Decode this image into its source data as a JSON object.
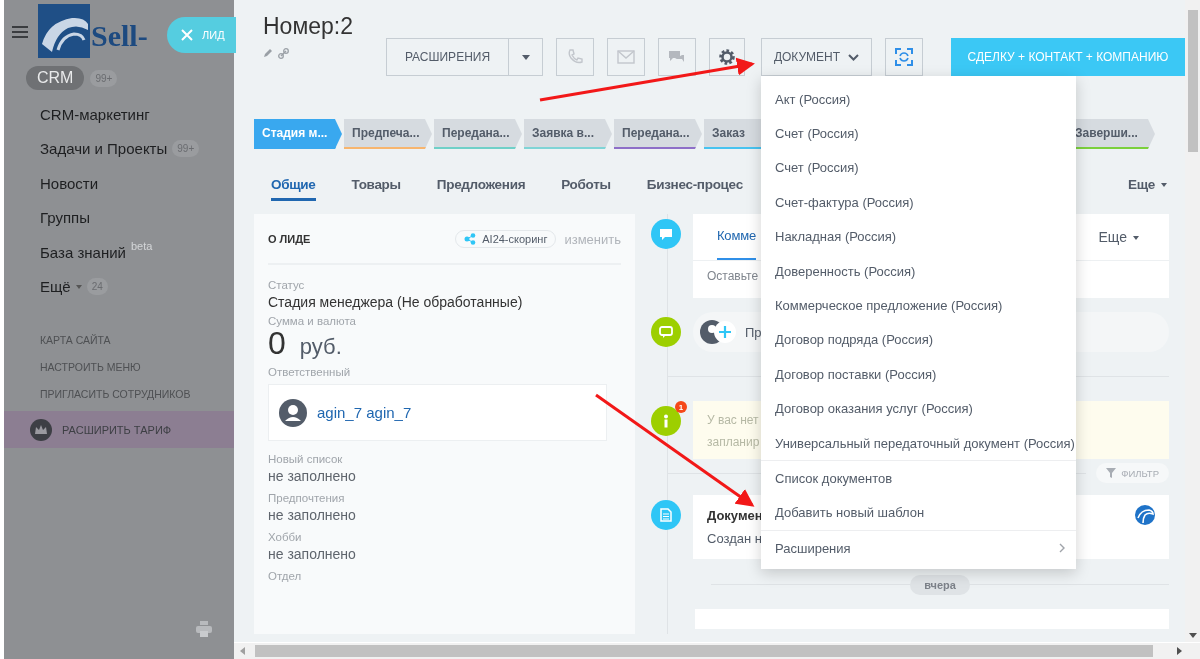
{
  "sidebar": {
    "logo_text": "Sell-",
    "close_tab": {
      "label": "ЛИД"
    },
    "crm": {
      "label": "CRM",
      "counter": "99+"
    },
    "items": [
      {
        "label": "CRM-маркетинг",
        "kind": "plain"
      },
      {
        "label": "Задачи и Проекты",
        "kind": "plain",
        "counter": "99+"
      },
      {
        "label": "Новости",
        "kind": "plain"
      },
      {
        "label": "Группы",
        "kind": "plain"
      },
      {
        "label": "База знаний",
        "kind": "plain",
        "sup": "beta"
      },
      {
        "label": "Ещё",
        "kind": "more",
        "counter": "24"
      }
    ],
    "links": [
      "КАРТА САЙТА",
      "НАСТРОИТЬ МЕНЮ",
      "ПРИГЛАСИТЬ СОТРУДНИКОВ"
    ],
    "upgrade": "РАСШИРИТЬ ТАРИФ"
  },
  "header": {
    "title": "Номер:2",
    "extensions_button": "РАСШИРЕНИЯ",
    "document_button": "ДОКУМЕНТ",
    "create_button": "СДЕЛКУ + КОНТАКТ + КОМПАНИЮ"
  },
  "stages": [
    {
      "label": "Стадия м...",
      "selected": true,
      "color": "#39a8ef"
    },
    {
      "label": "Предпеча...",
      "selected": false,
      "color": "#f7b56e"
    },
    {
      "label": "Передана...",
      "selected": false,
      "color": "#6fd0c8"
    },
    {
      "label": "Заявка в...",
      "selected": false,
      "color": "#7fd4d6"
    },
    {
      "label": "Передана...",
      "selected": false,
      "color": "#8e6fc8"
    },
    {
      "label": "Заказ",
      "selected": false,
      "color": "#47c3f0"
    },
    {
      "label": "Заверши...",
      "selected": false,
      "color": "#7bd03c"
    }
  ],
  "tabs": [
    {
      "label": "Общие",
      "selected": true
    },
    {
      "label": "Товары",
      "selected": false
    },
    {
      "label": "Предложения",
      "selected": false
    },
    {
      "label": "Роботы",
      "selected": false
    },
    {
      "label": "Бизнес-процес",
      "selected": false
    }
  ],
  "more_tab": "Еще",
  "lead_card": {
    "title": "О ЛИДЕ",
    "scoring": "AI24-скоринг",
    "edit_link": "изменить",
    "status": {
      "label": "Статус",
      "value": "Стадия менеджера (Не обработанные)"
    },
    "amount": {
      "label": "Сумма и валюта",
      "value": "0",
      "currency": "руб."
    },
    "responsible": {
      "label": "Ответственный",
      "name": "agin_7 agin_7"
    },
    "fields": [
      {
        "label": "Новый список",
        "value": "не заполнено"
      },
      {
        "label": "Предпочтения",
        "value": "не заполнено"
      },
      {
        "label": "Хобби",
        "value": "не заполнено"
      },
      {
        "label": "Отдел"
      }
    ]
  },
  "timeline": {
    "comment_tab": "Комме",
    "comment_more": "Еще",
    "comment_placeholder": "Оставьте",
    "activity_text": "Пр",
    "notice_badge": "1",
    "notice_lines": [
      "У вас нет",
      "запланир"
    ],
    "filter": "ФИЛЬТР",
    "document_title": "Докумен",
    "document_text": "Создан н",
    "day_label": "вчера"
  },
  "document_menu": {
    "sections": [
      {
        "items": [
          {
            "label": "Акт (Россия)",
            "kind": "plain"
          },
          {
            "label": "Счет (Россия)",
            "kind": "plain"
          },
          {
            "label": "Счет (Россия)",
            "kind": "plain"
          },
          {
            "label": "Счет-фактура (Россия)",
            "kind": "plain"
          },
          {
            "label": "Накладная (Россия)",
            "kind": "plain"
          },
          {
            "label": "Доверенность (Россия)",
            "kind": "plain"
          },
          {
            "label": "Коммерческое предложение (Россия)",
            "kind": "plain"
          },
          {
            "label": "Договор подряда (Россия)",
            "kind": "plain"
          },
          {
            "label": "Договор поставки (Россия)",
            "kind": "plain"
          },
          {
            "label": "Договор оказания услуг (Россия)",
            "kind": "plain"
          },
          {
            "label": "Универсальный передаточный документ (Россия)",
            "kind": "plain"
          }
        ]
      },
      {
        "items": [
          {
            "label": "Список документов",
            "kind": "plain"
          },
          {
            "label": "Добавить новый шаблон",
            "kind": "plain"
          }
        ]
      },
      {
        "items": [
          {
            "label": "Расширения",
            "kind": "submenu"
          }
        ]
      }
    ]
  }
}
